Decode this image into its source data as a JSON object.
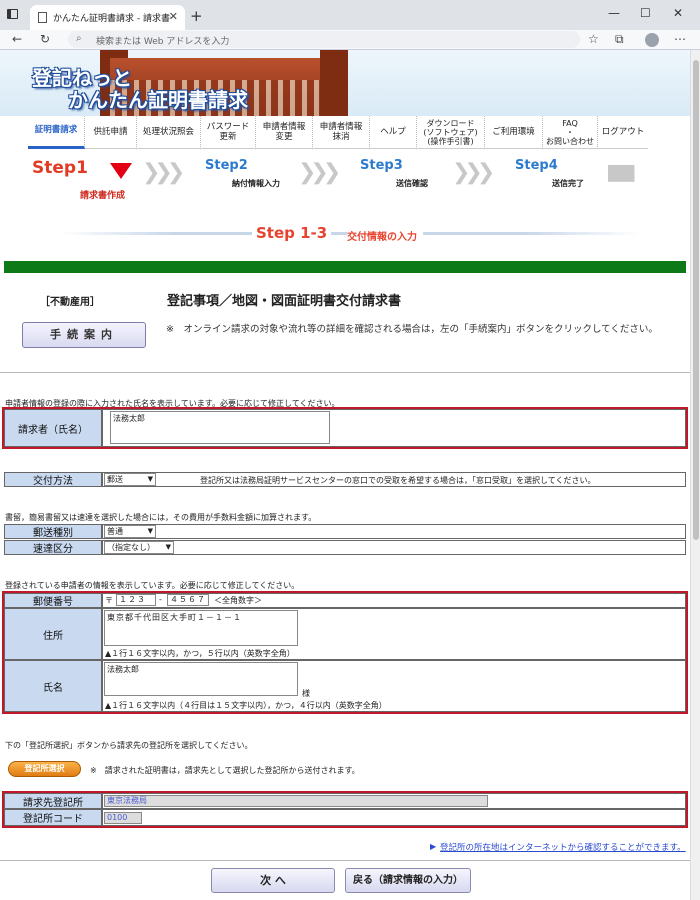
{
  "browser": {
    "tab_title": "かんたん証明書請求 - 請求書作成",
    "address_placeholder": "検索または Web アドレスを入力",
    "close_glyph": "✕",
    "newtab_glyph": "+",
    "min_glyph": "—",
    "max_glyph": "☐",
    "win_close_glyph": "✕",
    "back_glyph": "←",
    "reload_glyph": "↻",
    "search_glyph": "⌕",
    "more_glyph": "⋯",
    "fav_glyph": "☆",
    "collections_glyph": "⧉"
  },
  "banner": {
    "logo_line1": "登記ねっと",
    "logo_line2": "かんたん証明書請求"
  },
  "menu": {
    "items": [
      "証明書請求",
      "供託申請",
      "処理状況照会",
      "パスワード\n更新",
      "申請者情報\n変更",
      "申請者情報\n抹消",
      "ヘルプ",
      "ダウンロード\n(ソフトウェア)\n(操作手引書)",
      "ご利用環境",
      "FAQ\n・\nお問い合わせ",
      "ログアウト"
    ]
  },
  "steps": {
    "step1": "Step1",
    "step1_sub": "請求書作成",
    "step2": "Step2",
    "step2_sub": "納付情報入力",
    "step3": "Step3",
    "step3_sub": "送信確認",
    "step4": "Step4",
    "step4_sub": "送信完了"
  },
  "substep": {
    "title": "Step 1-3",
    "subtitle": "交付情報の入力"
  },
  "form": {
    "category": "［不動産用］",
    "title": "登記事項／地図・図面証明書交付請求書",
    "guide_button": "手続案内",
    "guide_note": "※　オンライン請求の対象や流れ等の詳細を確認される場合は，左の「手続案内」ボタンをクリックしてください。"
  },
  "requester": {
    "note": "申請者情報の登録の際に入力された氏名を表示しています。必要に応じて修正してください。",
    "label": "請求者（氏名）",
    "value": "法務太郎"
  },
  "delivery": {
    "label": "交付方法",
    "selected": "郵送",
    "note": "登記所又は法務局証明サービスセンターの窓口での受取を希望する場合は，「窓口受取」を選択してください。"
  },
  "mail": {
    "note": "書留，簡易書留又は速達を選択した場合には，その費用が手数料金額に加算されます。",
    "type_label": "郵送種別",
    "type_value": "普通",
    "express_label": "速達区分",
    "express_value": "（指定なし）"
  },
  "address": {
    "note": "登録されている申請者の情報を表示しています。必要に応じて修正してください。",
    "zip_label": "郵便番号",
    "zip_mark": "〒",
    "zip1": "１２３",
    "zip_sep": "-",
    "zip2": "４５６７",
    "zip_hint": "＜全角数字＞",
    "addr_label": "住所",
    "addr_value": "東京都千代田区大手町１－１－１",
    "addr_hint": "▲１行１６文字以内，かつ，５行以内（英数字全角）",
    "name_label": "氏名",
    "name_value": "法務太郎",
    "name_suffix": "様",
    "name_hint": "▲１行１６文字以内（４行目は１５文字以内），かつ，４行以内（英数字全角）"
  },
  "office": {
    "note": "下の「登記所選択」ボタンから請求先の登記所を選択してください。",
    "select_button": "登記所選択",
    "select_note": "※　請求された証明書は，請求先として選択した登記所から送付されます。",
    "dest_label": "請求先登記所",
    "dest_value": "東京法務局",
    "code_label": "登記所コード",
    "code_value": "0100",
    "link": "登記所の所在地はインターネットから確認することができます。",
    "link_glyph": "▶"
  },
  "buttons": {
    "next": "次 へ",
    "back": "戻る（請求情報の入力）"
  },
  "colors": {
    "accent_red": "#c0182a",
    "label_blue": "#c8d9f0",
    "green_bar": "#0c7a16",
    "step_blue": "#2d7bcf"
  }
}
